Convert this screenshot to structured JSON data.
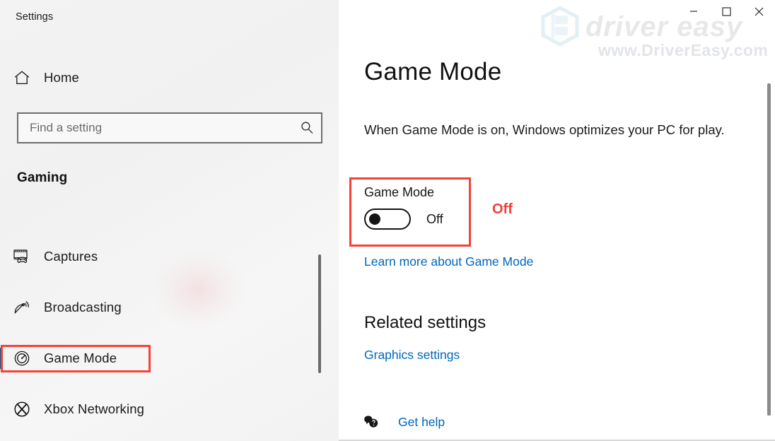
{
  "window": {
    "title": "Settings",
    "controls": [
      {
        "name": "minimize",
        "glyph": "minimize-icon"
      },
      {
        "name": "maximize",
        "glyph": "maximize-icon"
      },
      {
        "name": "close",
        "glyph": "close-icon"
      }
    ]
  },
  "watermark": {
    "brand": "driver easy",
    "url": "www.DriverEasy.com"
  },
  "sidebar": {
    "home_label": "Home",
    "home_icon": "home-icon",
    "search": {
      "placeholder": "Find a setting",
      "value": "",
      "icon": "search-icon"
    },
    "category": "Gaming",
    "items": [
      {
        "label": "Captures",
        "icon": "captures-icon",
        "selected": false
      },
      {
        "label": "Broadcasting",
        "icon": "broadcasting-icon",
        "selected": false
      },
      {
        "label": "Game Mode",
        "icon": "game-mode-icon",
        "selected": true
      },
      {
        "label": "Xbox Networking",
        "icon": "xbox-icon",
        "selected": false
      }
    ]
  },
  "main": {
    "heading": "Game Mode",
    "description": "When Game Mode is on, Windows optimizes your PC for play.",
    "toggle": {
      "label": "Game Mode",
      "state_label": "Off",
      "checked": false
    },
    "learn_more_link": "Learn more about Game Mode",
    "related_settings_heading": "Related settings",
    "graphics_settings_link": "Graphics settings",
    "get_help_link": "Get help",
    "get_help_icon": "help-chat-icon"
  },
  "annotations": {
    "toggle_state_callout": "Off",
    "highlight_color": "#f44336",
    "callout_color": "#ef4040"
  },
  "colors": {
    "accent_link": "#0067b8",
    "selection_bar": "#005a9e",
    "sidebar_bg": "#f2f2f2",
    "content_bg": "#ffffff"
  }
}
